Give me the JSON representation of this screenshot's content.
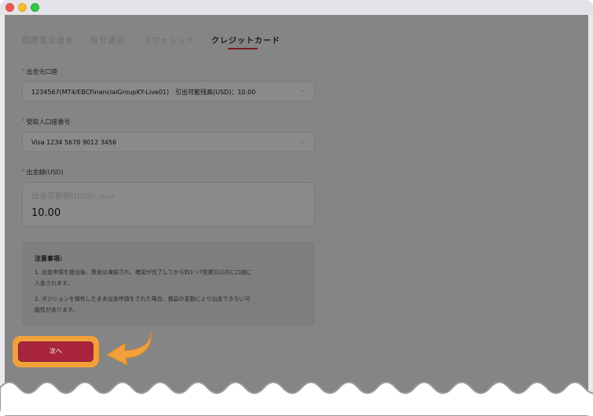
{
  "tabs": [
    {
      "label": "国際電信送金"
    },
    {
      "label": "暗号通貨"
    },
    {
      "label": "Eウォレット"
    },
    {
      "label": "クレジットカード"
    }
  ],
  "source_account": {
    "required_mark": "*",
    "label": "出金元口座",
    "value": "1234567(MT4/EBCFinancialGroupKY-Live01)　引出可能残高(USD)：10.00"
  },
  "recipient_account": {
    "required_mark": "*",
    "label": "受取人口座番号",
    "value": "Visa 1234 5678 9012 3456"
  },
  "amount": {
    "required_mark": "*",
    "label": "出金額(USD)",
    "placeholder_main": "出金可能額(USD):",
    "placeholder_value": "10.00",
    "value": "10.00"
  },
  "notice": {
    "title": "注意事項:",
    "lines": [
      "1. 出金申請を提出後、資金は凍結され、確認が完了してから約1～7営業日以内に口座に",
      "入金されます。",
      "2. ポジションを保有したまま出金申請をされた場合、損益の変動により出金できない可",
      "能性があります。"
    ]
  },
  "next_button": {
    "label": "次へ"
  },
  "colors": {
    "accent": "#a8253c",
    "highlight": "#f2a13a",
    "overlay": "#858585"
  }
}
